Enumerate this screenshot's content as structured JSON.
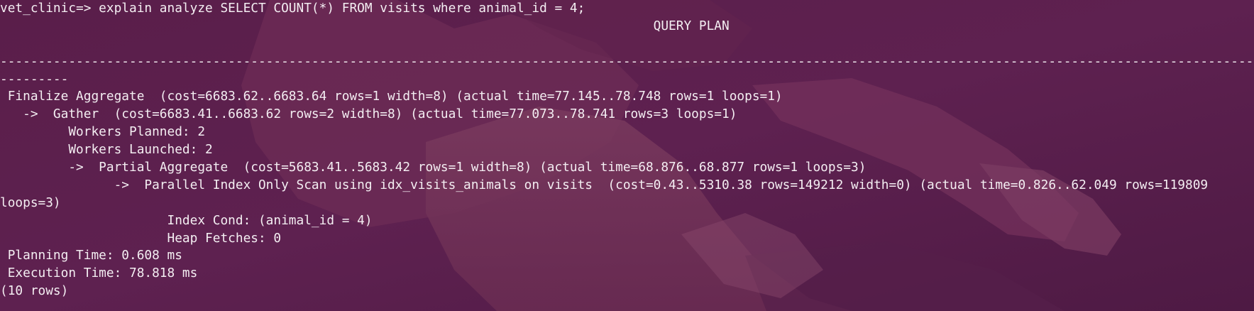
{
  "terminal": {
    "background_color": "#5b1f4c",
    "text_color": "#f4eef2",
    "background_image": "island-coastline-wallpaper",
    "lines": [
      "vet_clinic=> explain analyze SELECT COUNT(*) FROM visits where animal_id = 4;",
      "                                                                                      QUERY PLAN",
      "",
      "-----------------------------------------------------------------------------------------------------------------------------------------------------------------------------------",
      "---------",
      " Finalize Aggregate  (cost=6683.62..6683.64 rows=1 width=8) (actual time=77.145..78.748 rows=1 loops=1)",
      "   ->  Gather  (cost=6683.41..6683.62 rows=2 width=8) (actual time=77.073..78.741 rows=3 loops=1)",
      "         Workers Planned: 2",
      "         Workers Launched: 2",
      "         ->  Partial Aggregate  (cost=5683.41..5683.42 rows=1 width=8) (actual time=68.876..68.877 rows=1 loops=3)",
      "               ->  Parallel Index Only Scan using idx_visits_animals on visits  (cost=0.43..5310.38 rows=149212 width=0) (actual time=0.826..62.049 rows=119809",
      "loops=3)",
      "                      Index Cond: (animal_id = 4)",
      "                      Heap Fetches: 0",
      " Planning Time: 0.608 ms",
      " Execution Time: 78.818 ms",
      "(10 rows)"
    ]
  }
}
